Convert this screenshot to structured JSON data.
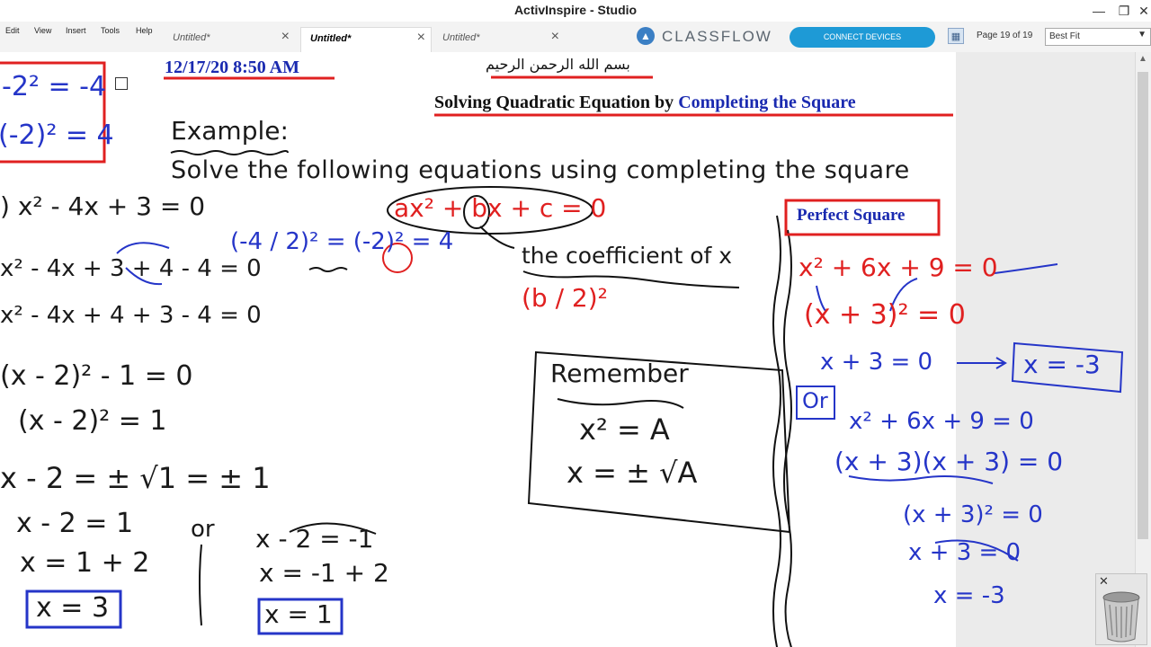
{
  "window": {
    "title": "ActivInspire - Studio",
    "minimize": "—",
    "restore": "❐",
    "close": "✕"
  },
  "menu": [
    "Edit",
    "View",
    "Insert",
    "Tools",
    "Help"
  ],
  "tabs": [
    {
      "label": "Untitled*",
      "active": false
    },
    {
      "label": "Untitled*",
      "active": true
    },
    {
      "label": "Untitled*",
      "active": false
    }
  ],
  "toolbar": {
    "brand": "CLASSFLOW",
    "connect_label": "CONNECT DEVICES",
    "page_counter": "Page 19 of 19",
    "zoom_value": "Best Fit"
  },
  "slide": {
    "date": "12/17/20 8:50 AM",
    "basmala": "بسم الله الرحمن الرحيم",
    "title_prefix": "Solving Quadratic Equation by ",
    "title_highlight": "Completing the Square",
    "example_label": "Example:",
    "instruction": "Solve the following equations using completing the square",
    "left_panel": {
      "box_line1": "-2² = -4",
      "box_line2": "(-2)² = 4",
      "steps": [
        ") x² - 4x + 3 = 0",
        "x² - 4x + 3 + 4 - 4 = 0",
        "x² - 4x + 4 + 3 - 4 = 0",
        "(x - 2)² - 1 = 0",
        "(x - 2)² = 1",
        "x - 2 = ± √1 = ± 1",
        "x - 2 = 1",
        "x = 1 + 2",
        "x = 3"
      ],
      "or_label": "or",
      "alt_steps": [
        "x - 2 = -1",
        "x = -1 + 2",
        "x = 1"
      ]
    },
    "middle": {
      "half_coef": "(-4 / 2)² = (-2)² = 4",
      "general_form": "ax² + bx + c = 0",
      "coef_note": "the coefficient of x",
      "b_over_2": "(b / 2)²",
      "remember_label": "Remember",
      "remember_line1": "x² = A",
      "remember_line2": "x = ± √A"
    },
    "right_panel": {
      "label": "Perfect Square",
      "eq1": "x² + 6x + 9 = 0",
      "eq2": "(x + 3)² = 0",
      "eq3": "x + 3 = 0",
      "answer": "x = -3",
      "or_label": "Or",
      "eq4": "x² + 6x + 9 = 0",
      "eq5": "(x + 3)(x + 3) = 0",
      "eq6": "(x + 3)² = 0",
      "eq7": "x + 3 = 0",
      "eq8": "x = -3"
    }
  },
  "trash": {
    "close": "✕"
  }
}
